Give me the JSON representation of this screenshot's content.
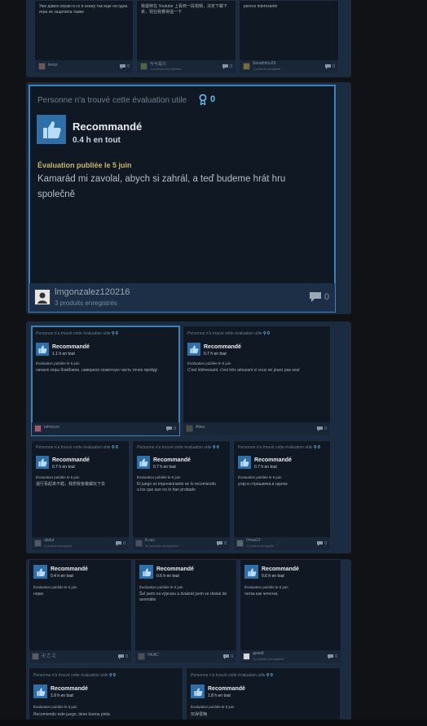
{
  "top_row": [
    {
      "body": "Уже давно играю в сх и скажу так еще ни одна игра не зацепила также",
      "user": "levos",
      "comments": "0"
    },
    {
      "body": "我還特在 Youtube 上看到一段視頻，決定下載下來，現在我覺得還一下",
      "user": "兮兮是只",
      "products": "4 produits enregistrés",
      "comments": "0"
    },
    {
      "body": "parece interesante",
      "user": "Seradinho29",
      "products": "1 produit enregistré",
      "comments": "0"
    }
  ],
  "featured": {
    "helpful": "Personne n'a trouvé cette évaluation utile",
    "award_count": "0",
    "recommend": "Recommandé",
    "hours": "0.4 h en tout",
    "posted": "Évaluation publiée le 5 juin",
    "body": "Kamarád mi zavolal, abych si zahrál, a teď budeme hrát hru společně",
    "user": "lmgonzalez120216",
    "products": "3 produits enregistrés",
    "comments": "0"
  },
  "group3": {
    "top": [
      {
        "helpful": "Personne n'a trouvé cette évaluation utile",
        "award": "0",
        "recommend": "Recommandé",
        "hours": "1.1 h en tout",
        "posted": "Évaluation publiée le 5 juin",
        "body": "начало игры бомбовое, наверное сюжетную часть точно пройду",
        "user": "lahrezzo",
        "comments": "0"
      },
      {
        "helpful": "Personne n'a trouvé cette évaluation utile",
        "award": "0",
        "recommend": "Recommandé",
        "hours": "0.7 h en tout",
        "posted": "Évaluation publiée le 5 juin",
        "body": "C'est intéressant. c'est très amusant si vous ne jouez pas seul",
        "user": "Attev",
        "comments": "0"
      }
    ],
    "bottom": [
      {
        "helpful": "Personne n'a trouvé cette évaluation utile",
        "award": "0",
        "recommend": "Recommandé",
        "hours": "0.7 h en tout",
        "posted": "Évaluation publiée le 5 juin",
        "body": "還行看起來不錯，我想我會繼續玩下去",
        "user": "abdul",
        "products": "1 produit enregistré",
        "comments": "0"
      },
      {
        "helpful": "Personne n'a trouvé cette évaluation utile",
        "award": "0",
        "recommend": "Recommandé",
        "hours": "0.7 h en tout",
        "posted": "Évaluation publiée le 5 juin",
        "body": "El juego es impresionante se lo recomiendo a los que aun no lo han probado",
        "user": "fr.cac",
        "products": "26 produits enregistrés",
        "comments": "0"
      },
      {
        "helpful": "Personne n'a trouvé cette évaluation utile",
        "award": "0",
        "recommend": "Recommandé",
        "hours": "0.7 h en tout",
        "posted": "Évaluation publiée le 5 juin",
        "body": "угар и страшилка в одном",
        "user": "Omai13",
        "products": "1 produit enregistré",
        "comments": "0"
      }
    ]
  },
  "group4": {
    "top": [
      {
        "recommend": "Recommandé",
        "hours": "0.4 h en tout",
        "posted": "Évaluation publiée le 5 juin",
        "body": "норм",
        "user": "卍 乙 之",
        "comments": "0"
      },
      {
        "recommend": "Recommandé",
        "hours": "0.6 h en tout",
        "posted": "Évaluation publiée le 5 juin",
        "body": "Šel jsem na výpravu a dvakrát jsem se dostal do anomálie.",
        "user": "HKAC",
        "comments": "0"
      },
      {
        "recommend": "Recommandé",
        "hours": "0.6 h en tout",
        "posted": "Évaluation publiée le 5 juin",
        "body": "чотка как чечотка",
        "user": "дикий",
        "products": "2 produits enregistrés",
        "comments": "0"
      }
    ],
    "bottom": [
      {
        "helpful": "Personne n'a trouvé cette évaluation utile",
        "award": "0",
        "recommend": "Recommandé",
        "hours": "1.9 h en tout",
        "posted": "Évaluation publiée le 5 juin",
        "body": "Recomiendo este juego, tiene buena pinta."
      },
      {
        "helpful": "Personne n'a trouvé cette évaluation utile",
        "award": "0",
        "recommend": "Recommandé",
        "hours": "1.8 h en tout",
        "posted": "Évaluation publiée le 5 juin",
        "body": "玩得很嗨"
      }
    ]
  },
  "colors": {
    "accent": "#66c0f4",
    "thumb_bg": "#2e6fa7",
    "panel": "#1b2b40",
    "card": "#0f1823"
  }
}
